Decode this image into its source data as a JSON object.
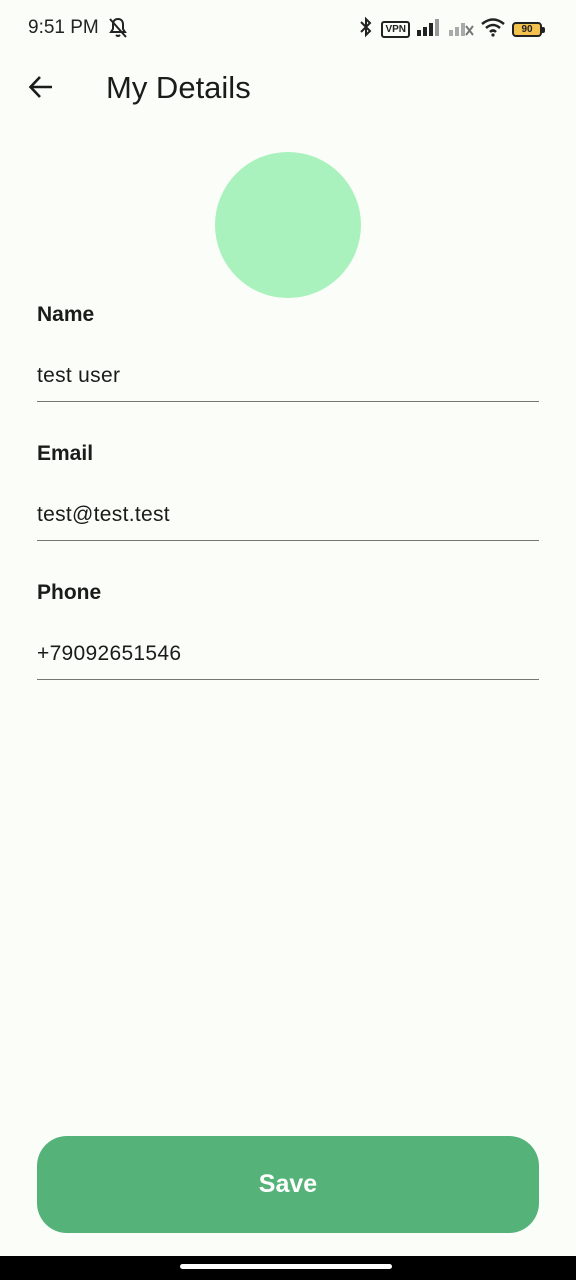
{
  "status_bar": {
    "time": "9:51 PM",
    "vpn_label": "VPN",
    "battery_level": "90",
    "icons": [
      "bell-off-icon",
      "bluetooth-icon",
      "vpn-icon",
      "signal-icon",
      "signal-no-service-icon",
      "wifi-icon",
      "battery-icon"
    ]
  },
  "app_bar": {
    "title": "My Details",
    "back_icon": "arrow-left-icon"
  },
  "avatar": {
    "color": "#a9f2bd"
  },
  "form": {
    "name": {
      "label": "Name",
      "value": "test user"
    },
    "email": {
      "label": "Email",
      "value": "test@test.test"
    },
    "phone": {
      "label": "Phone",
      "value": "+79092651546"
    }
  },
  "actions": {
    "save_label": "Save"
  },
  "colors": {
    "background": "#fbfdf8",
    "primary": "#55b37a",
    "avatar": "#a9f2bd"
  }
}
